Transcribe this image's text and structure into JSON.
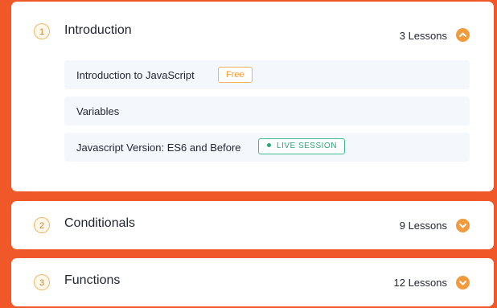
{
  "sections": [
    {
      "number": "1",
      "title": "Introduction",
      "lesson_count": "3 Lessons",
      "expanded": true,
      "lessons": [
        {
          "title": "Introduction to JavaScript",
          "badge": "Free"
        },
        {
          "title": "Variables"
        },
        {
          "title": "Javascript Version: ES6 and Before",
          "badge": "LIVE SESSION"
        }
      ]
    },
    {
      "number": "2",
      "title": "Conditionals",
      "lesson_count": "9 Lessons",
      "expanded": false
    },
    {
      "number": "3",
      "title": "Functions",
      "lesson_count": "12 Lessons",
      "expanded": false
    }
  ],
  "colors": {
    "background": "#f0582a",
    "accent": "#f39a3c",
    "live": "#2ea57a"
  },
  "icons": {
    "expanded": "chevron-up-icon",
    "collapsed": "chevron-down-icon"
  }
}
